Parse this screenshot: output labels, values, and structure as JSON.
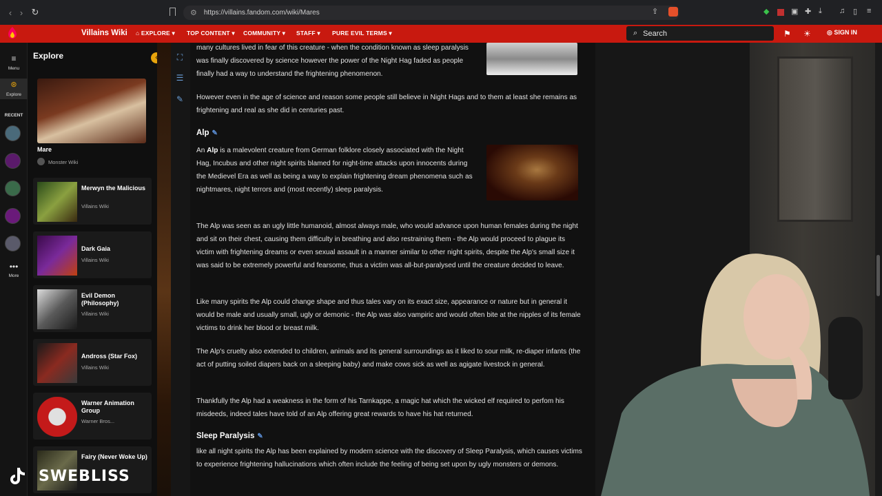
{
  "browser": {
    "url": "https://villains.fandom.com/wiki/Mares"
  },
  "wiki": {
    "name": "Villains Wiki",
    "nav": [
      "EXPLORE",
      "TOP CONTENT",
      "COMMUNITY",
      "STAFF",
      "PURE EVIL TERMS"
    ],
    "search_placeholder": "Search",
    "signin": "SIGN IN"
  },
  "rail": {
    "menu": "Menu",
    "explore": "Explore",
    "recent": "RECENT",
    "more": "More"
  },
  "explore": {
    "title": "Explore",
    "cards": [
      {
        "title": "Mare",
        "sub": "Monster Wiki"
      },
      {
        "title": "Merwyn the Malicious",
        "sub": "Villains Wiki"
      },
      {
        "title": "Dark Gaia",
        "sub": "Villains Wiki"
      },
      {
        "title": "Evil Demon (Philosophy)",
        "sub": "Villains Wiki"
      },
      {
        "title": "Andross (Star Fox)",
        "sub": "Villains Wiki"
      },
      {
        "title": "Warner Animation Group",
        "sub": "Warner Bros..."
      },
      {
        "title": "Fairy (Never Woke Up)",
        "sub": ""
      }
    ]
  },
  "article": {
    "p_top": "many cultures lived in fear of this creature - when the condition known as sleep paralysis was finally discovered by science however the power of the Night Hag faded as people finally had a way to understand the frightening phenomenon.",
    "p_science": "However even in the age of science and reason some people still believe in Night Hags and to them at least she remains as frightening and real as she did in centuries past.",
    "h_alp": "Alp",
    "p_alp1_a": "An ",
    "p_alp1_b": "Alp",
    "p_alp1_c": " is a malevolent creature from German folklore closely associated with the Night Hag, Incubus and other night spirits blamed for night-time attacks upon innocents during the Medievel Era as well as being a way to explain frightening dream phenomena such as nightmares, night terrors and (most recently) sleep paralysis.",
    "p_alp2": "The Alp was seen as an ugly little humanoid, almost always male, who would advance upon human females during the night and sit on their chest, causing them difficulty in breathing and also restraining them - the Alp would proceed to plague its victim with frightening dreams or even sexual assault in a manner similar to other night spirits, despite the Alp's small size it was said to be extremely powerful and fearsome, thus a victim was all-but-paralysed until the creature decided to leave.",
    "p_alp3": "Like many spirits the Alp could change shape and thus tales vary on its exact size, appearance or nature but in general it would be male and usually small, ugly or demonic - the Alp was also vampiric and would often bite at the nipples of its female victims to drink her blood or breast milk.",
    "p_alp4": "The Alp's cruelty also extended to children, animals and its general surroundings as it liked to sour milk, re-diaper infants (the act of putting soiled diapers back on a sleeping baby) and make cows sick as well as agigate livestock in general.",
    "p_alp5": "Thankfully the Alp had a weakness in the form of his Tarnkappe, a magic hat which the wicked elf required to perfom his misdeeds, indeed tales have told of an Alp offering great rewards to have his hat returned.",
    "h_sleep": "Sleep Paralysis",
    "p_sleep": "like all night spirits the Alp has been explained by modern science with the discovery of Sleep Paralysis, which causes victims to experience frightening hallucinations which often include the feeling of being set upon by ugly monsters or demons."
  },
  "overlay": {
    "watermark": "SWEBLISS"
  }
}
